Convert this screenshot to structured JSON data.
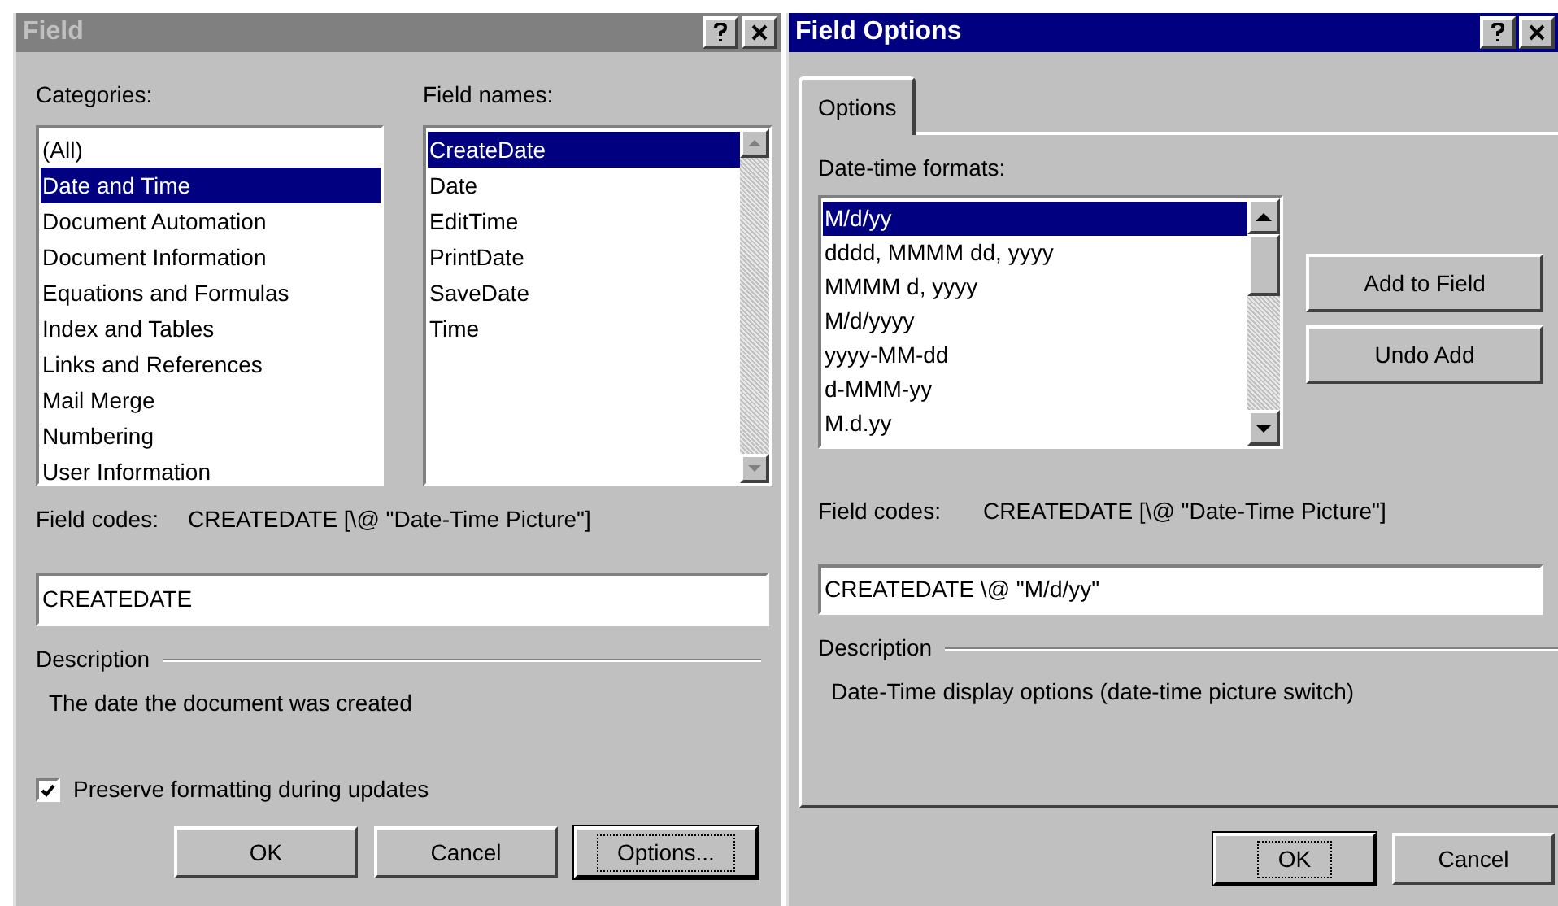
{
  "field_dialog": {
    "title": "Field",
    "active": false,
    "categories": {
      "label": "Categories:",
      "items": [
        {
          "label": "(All)",
          "selected": false
        },
        {
          "label": "Date and Time",
          "selected": true
        },
        {
          "label": "Document Automation",
          "selected": false
        },
        {
          "label": "Document Information",
          "selected": false
        },
        {
          "label": "Equations and Formulas",
          "selected": false
        },
        {
          "label": "Index and Tables",
          "selected": false
        },
        {
          "label": "Links and References",
          "selected": false
        },
        {
          "label": "Mail Merge",
          "selected": false
        },
        {
          "label": "Numbering",
          "selected": false
        },
        {
          "label": "User Information",
          "selected": false
        }
      ]
    },
    "field_names": {
      "label": "Field names:",
      "items": [
        {
          "label": "CreateDate",
          "selected": true
        },
        {
          "label": "Date",
          "selected": false
        },
        {
          "label": "EditTime",
          "selected": false
        },
        {
          "label": "PrintDate",
          "selected": false
        },
        {
          "label": "SaveDate",
          "selected": false
        },
        {
          "label": "Time",
          "selected": false
        }
      ]
    },
    "field_codes": {
      "label": "Field codes:",
      "value": "CREATEDATE [\\@ \"Date-Time Picture\"]"
    },
    "code_input": {
      "value": "CREATEDATE"
    },
    "description": {
      "label": "Description",
      "text": "The date the document was created"
    },
    "preserve_formatting": {
      "label": "Preserve formatting during updates",
      "checked": true
    },
    "buttons": [
      {
        "label": "OK",
        "default": false
      },
      {
        "label": "Cancel",
        "default": false
      },
      {
        "label": "Options...",
        "default": true
      }
    ]
  },
  "options_dialog": {
    "title": "Field Options",
    "active": true,
    "tabs": [
      {
        "label": "Options",
        "selected": true
      }
    ],
    "formats": {
      "label": "Date-time formats:",
      "items": [
        {
          "label": "M/d/yy",
          "selected": true
        },
        {
          "label": "dddd, MMMM dd, yyyy",
          "selected": false
        },
        {
          "label": "MMMM d, yyyy",
          "selected": false
        },
        {
          "label": "M/d/yyyy",
          "selected": false
        },
        {
          "label": "yyyy-MM-dd",
          "selected": false
        },
        {
          "label": "d-MMM-yy",
          "selected": false
        },
        {
          "label": "M.d.yy",
          "selected": false
        }
      ]
    },
    "side_buttons": [
      "Add to Field",
      "Undo Add"
    ],
    "field_codes": {
      "label": "Field codes:",
      "value": "CREATEDATE [\\@ \"Date-Time Picture\"]"
    },
    "code_input": {
      "value": "CREATEDATE \\@ \"M/d/yy\""
    },
    "description": {
      "label": "Description",
      "text": "Date-Time display options (date-time picture switch)"
    },
    "buttons": [
      {
        "label": "OK",
        "default": true
      },
      {
        "label": "Cancel",
        "default": false
      }
    ]
  }
}
